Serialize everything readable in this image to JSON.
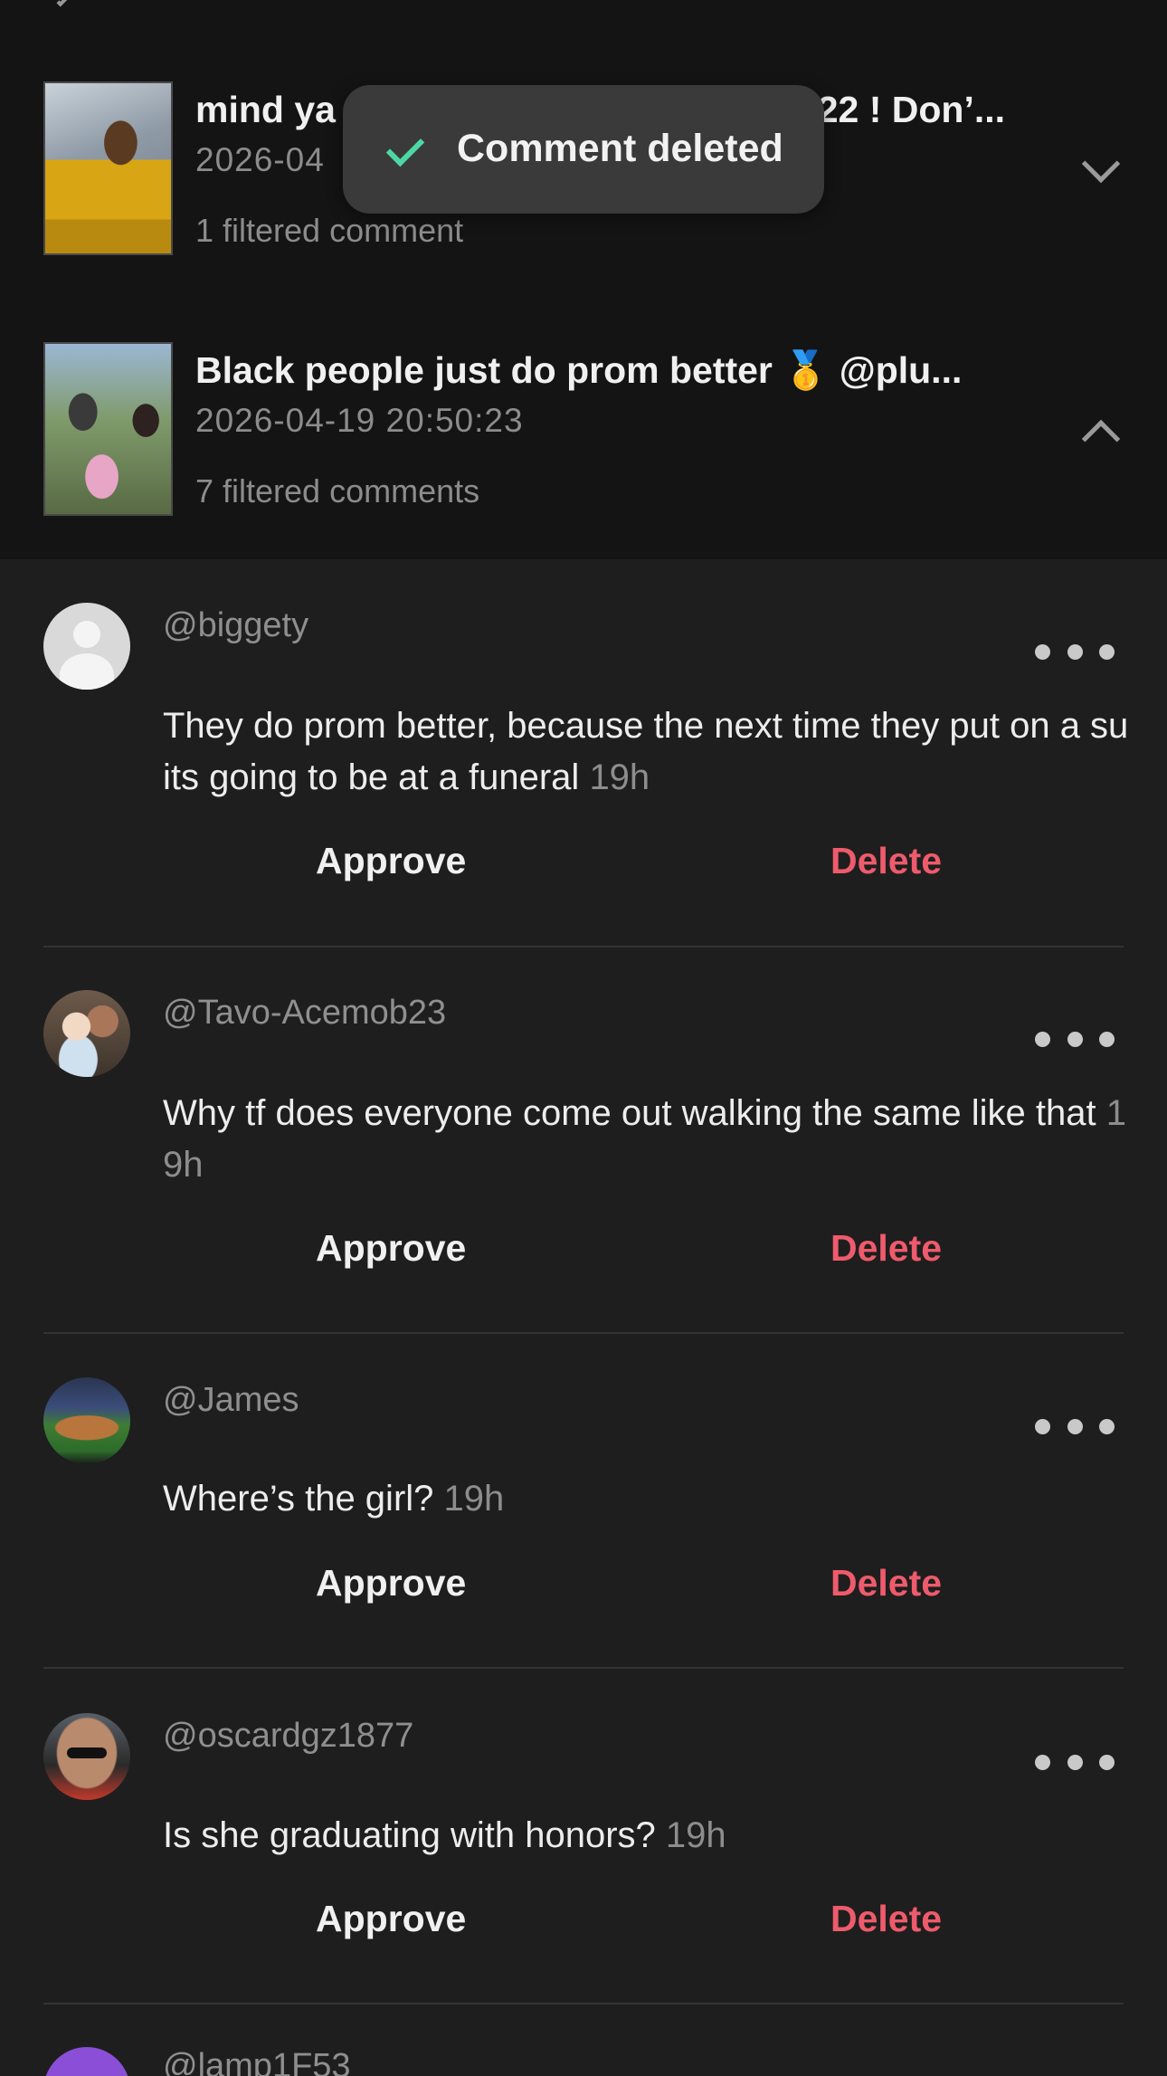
{
  "toast": {
    "text": "Comment deleted",
    "icon": "check-icon",
    "icon_color": "#4cd7a4"
  },
  "videos": [
    {
      "title_visible_start": "mind ya",
      "title_visible_end": "022 ! Don’...",
      "date_visible": "2026-04",
      "filtered": "1 filtered comment",
      "expanded": false
    },
    {
      "title": "Black people just do prom better 🥇 @plu...",
      "date": "2026-04-19 20:50:23",
      "filtered": "7 filtered comments",
      "expanded": true
    }
  ],
  "actions": {
    "approve": "Approve",
    "delete": "Delete"
  },
  "comments": [
    {
      "username": "@biggety",
      "text": "They do prom better, because the next time they put on a suits going to be at a funeral",
      "time": "19h"
    },
    {
      "username": "@Tavo-Acemob23",
      "text": "Why tf does everyone come out walking the same like that",
      "time": "19h"
    },
    {
      "username": "@James",
      "text": "Where’s the girl?",
      "time": "19h"
    },
    {
      "username": "@oscardgz1877",
      "text": "Is she graduating with honors?",
      "time": "19h"
    },
    {
      "username": "@lamp1F53"
    }
  ],
  "colors": {
    "delete": "#ee5b6c",
    "background": "#1e1e1e",
    "header_bg": "#141414"
  }
}
